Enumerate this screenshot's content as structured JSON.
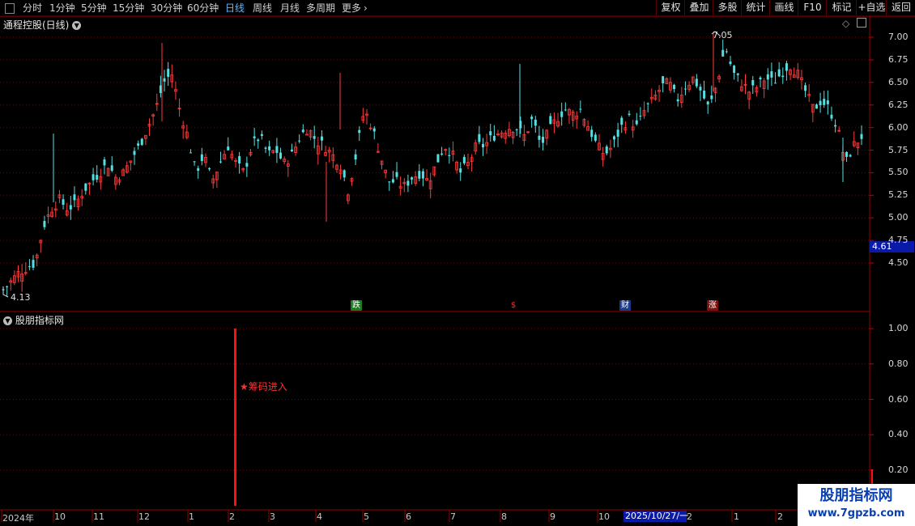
{
  "toolbar": {
    "periods": [
      {
        "label": "分时"
      },
      {
        "label": "1分钟"
      },
      {
        "label": "5分钟"
      },
      {
        "label": "15分钟"
      },
      {
        "label": "30分钟"
      },
      {
        "label": "60分钟"
      },
      {
        "label": "日线"
      },
      {
        "label": "周线"
      },
      {
        "label": "月线"
      },
      {
        "label": "多周期"
      },
      {
        "label": "更多"
      }
    ],
    "active_period": "日线",
    "more_arrow": "›",
    "tools": [
      {
        "label": "复权"
      },
      {
        "label": "叠加"
      },
      {
        "label": "多股"
      },
      {
        "label": "统计"
      },
      {
        "label": "画线"
      },
      {
        "label": "F10"
      },
      {
        "label": "标记"
      },
      {
        "label": "+自选"
      },
      {
        "label": "返回"
      }
    ]
  },
  "main_panel": {
    "title": "通程控股(日线)",
    "high_label": "7.05",
    "low_label": "4.13",
    "current_price_tag": "4.61",
    "y_ticks": [
      "7.00",
      "6.75",
      "6.50",
      "6.25",
      "6.00",
      "5.75",
      "5.50",
      "5.25",
      "5.00",
      "4.75",
      "4.50"
    ],
    "markers": [
      {
        "text": "跌",
        "bg": "#1e7a1e",
        "color": "#ffffff"
      },
      {
        "text": "$",
        "bg": "#000000",
        "color": "#ff3030"
      },
      {
        "text": "财",
        "bg": "#1a3a8a",
        "color": "#ffffff"
      },
      {
        "text": "涨",
        "bg": "#7a1010",
        "color": "#ffffff"
      }
    ]
  },
  "indicator_panel": {
    "title": "股朋指标网",
    "signal_label": "★筹码进入",
    "y_ticks": [
      "1.00",
      "0.80",
      "0.60",
      "0.40",
      "0.20"
    ]
  },
  "date_axis": {
    "labels": [
      "2024年",
      "10",
      "11",
      "12",
      "1",
      "2",
      "3",
      "4",
      "5",
      "6",
      "7",
      "8",
      "9",
      "10",
      "2",
      "1",
      "2"
    ],
    "cursor_date": "2025/10/27/一"
  },
  "watermark": {
    "line1": "股朋指标网",
    "line2": "www.7gpzb.com"
  },
  "colors": {
    "up": "#ff3b3b",
    "down": "#54e0e0",
    "grid": "#8a0000",
    "active_tab": "#5fb8ff"
  },
  "chart_data": {
    "type": "candlestick",
    "title": "通程控股(日线)",
    "ylim": [
      4.13,
      7.05
    ],
    "y_ticks": [
      7.0,
      6.75,
      6.5,
      6.25,
      6.0,
      5.75,
      5.5,
      5.25,
      5.0,
      4.75,
      4.5
    ],
    "period_high": 7.05,
    "period_low": 4.13,
    "last_price": 4.61,
    "x_ticks": [
      "2024年",
      "10",
      "11",
      "12",
      "1",
      "2",
      "3",
      "4",
      "5",
      "6",
      "7",
      "8",
      "9",
      "10",
      "2",
      "1",
      "2"
    ],
    "close_path_approx": [
      4.2,
      4.3,
      4.4,
      4.45,
      4.5,
      4.9,
      5.1,
      5.2,
      5.1,
      5.15,
      5.3,
      5.4,
      5.5,
      5.6,
      5.45,
      5.5,
      5.65,
      5.8,
      6.0,
      6.2,
      6.5,
      6.6,
      6.2,
      5.9,
      5.5,
      5.7,
      5.4,
      5.6,
      5.8,
      5.6,
      5.5,
      5.8,
      5.9,
      5.7,
      5.75,
      5.6,
      5.7,
      5.9,
      6.0,
      5.85,
      5.8,
      5.7,
      5.6,
      5.3,
      5.7,
      6.2,
      6.0,
      5.7,
      5.4,
      5.4,
      5.35,
      5.45,
      5.5,
      5.4,
      5.6,
      5.8,
      5.7,
      5.5,
      5.6,
      5.8,
      5.8,
      5.9,
      5.95,
      6.0,
      6.0,
      5.9,
      6.1,
      5.8,
      5.95,
      6.1,
      6.2,
      6.15,
      6.2,
      6.0,
      5.8,
      5.7,
      5.8,
      6.0,
      6.1,
      6.0,
      6.2,
      6.3,
      6.45,
      6.5,
      6.3,
      6.45,
      6.55,
      6.4,
      6.2,
      6.5,
      6.9,
      6.6,
      6.5,
      6.4,
      6.45,
      6.55,
      6.5,
      6.6,
      6.7,
      6.6,
      6.4,
      6.2,
      6.3,
      6.2,
      6.0,
      5.6,
      5.8,
      5.9
    ],
    "indicator": {
      "name": "股朋指标网",
      "ylim": [
        0,
        1
      ],
      "y_ticks": [
        1.0,
        0.8,
        0.6,
        0.4,
        0.2
      ],
      "signal_bars": [
        {
          "index": 56,
          "value": 1.0,
          "label": "★筹码进入"
        }
      ]
    }
  }
}
